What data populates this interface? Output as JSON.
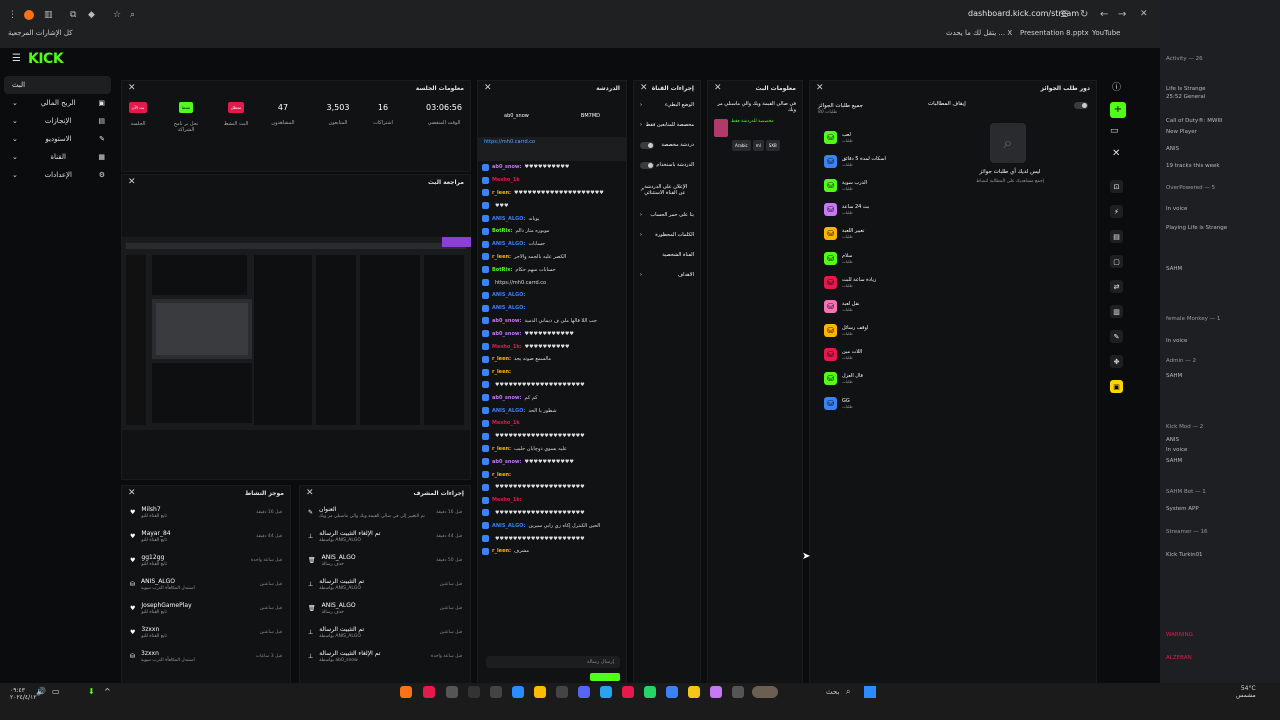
{
  "browser": {
    "url": "dashboard.kick.com/stream",
    "bookmarks": [
      {
        "label": "كل الإشارات المرجعية"
      },
      {
        "label": "يتقل لك ما يحدث ... X"
      },
      {
        "label": "Presentation 8.pptx"
      },
      {
        "label": "YouTube"
      }
    ]
  },
  "app": {
    "logo": "KICK",
    "sidebar": [
      {
        "label": "البث",
        "active": true
      },
      {
        "label": "الربح المالي"
      },
      {
        "label": "الإنجازات"
      },
      {
        "label": "الاستوديو"
      },
      {
        "label": "القناة"
      },
      {
        "label": "الإعدادات"
      }
    ]
  },
  "session": {
    "title": "معلومات الجلسة",
    "stats": [
      {
        "value": "",
        "label": "الجلسة",
        "badge": "بث الآن",
        "badge_color": "#e5194b"
      },
      {
        "value": "",
        "label": "نحل بر نامج الشراكة",
        "badge": "نشط",
        "badge_color": "#53fc18"
      },
      {
        "value": "",
        "label": "البث النشط",
        "badge": "معطل",
        "badge_color": "#e5194b"
      },
      {
        "value": "47",
        "label": "المشاهدون"
      },
      {
        "value": "3,503",
        "label": "المتابعون"
      },
      {
        "value": "16",
        "label": "اشتراكات"
      },
      {
        "value": "03:06:56",
        "label": "الوقت المنقضي"
      }
    ]
  },
  "preview": {
    "title": "مراجعة البث"
  },
  "activity": {
    "title": "موجز النشاط",
    "items": [
      {
        "name": "Milsh7",
        "sub": "تابع القناة للتو",
        "time": "قبل 16 دقيقة"
      },
      {
        "name": "Mayar_84",
        "sub": "تابع القناة للتو",
        "time": "قبل 44 دقيقة"
      },
      {
        "name": "gg12gg",
        "sub": "تابع القناة للتو",
        "time": "قبل ساعة واحدة"
      },
      {
        "name": "ANIS_ALGO",
        "sub": "استبدل المكافأة الدرب سوية",
        "time": "قبل ساعتين"
      },
      {
        "name": "JosephGamePlay",
        "sub": "تابع القناة للتو",
        "time": "قبل ساعتين"
      },
      {
        "name": "3zxxn",
        "sub": "تابع القناة للتو",
        "time": "قبل ساعتين"
      },
      {
        "name": "3zxxn",
        "sub": "استبدل المكافأة الدرب سوية",
        "time": "قبل 3 ساعات"
      }
    ]
  },
  "modactions": {
    "title": "إجراءات المشرف",
    "items": [
      {
        "name": "العنوان",
        "sub": "تم التغيير إلى في صالي القيمة ويك والي ماسنلي مر ويك",
        "time": "قبل 16 دقيقة"
      },
      {
        "name": "تم الإلغاء التثبيت الرسالة",
        "sub": "بواسطة ANIS_ALGO",
        "time": "قبل 44 دقيقة"
      },
      {
        "name": "ANIS_ALGO",
        "sub": "حذف رسالة",
        "time": "قبل 50 دقيقة"
      },
      {
        "name": "تم التثبيت الرسالة",
        "sub": "بواسطة ANIS_ALGO",
        "time": "قبل ساعتين"
      },
      {
        "name": "ANIS_ALGO",
        "sub": "حذف رسالة",
        "time": "قبل ساعتين"
      },
      {
        "name": "تم التثبيت الرسالة",
        "sub": "بواسطة ANIS_ALGO",
        "time": "قبل ساعتين"
      },
      {
        "name": "تم الإلغاء التثبيت الرسالة",
        "sub": "بواسطة ab0_snow",
        "time": "قبل ساعة واحدة"
      }
    ]
  },
  "chat": {
    "title": "الدردشة",
    "pinned_top": {
      "a": "ab0_snow",
      "b": "BM7MD"
    },
    "pinned_link": "https://mh0.carrd.co",
    "input_placeholder": "إرسال رسالة",
    "messages": [
      {
        "user": "ab0_snow:",
        "color": "#c678f5",
        "text": "♥♥♥♥♥♥♥♥♥♥"
      },
      {
        "user": "Mesho_1k",
        "color": "#e5194b",
        "text": ""
      },
      {
        "user": "r_leen:",
        "color": "#ffb400",
        "text": "♥♥♥♥♥♥♥♥♥♥♥♥♥♥♥♥♥♥♥♥"
      },
      {
        "user": "",
        "color": "#fff",
        "text": "♥♥♥"
      },
      {
        "user": "ANIS_ALGO:",
        "color": "#3b82f6",
        "text": "يوبانه"
      },
      {
        "user": "BotRix:",
        "color": "#53fc18",
        "text": "موبوره متار دالم"
      },
      {
        "user": "ANIS_ALGO:",
        "color": "#3b82f6",
        "text": "حسابات"
      },
      {
        "user": "r_leen:",
        "color": "#ffb400",
        "text": "الكصر عليه بالجمه والاجر"
      },
      {
        "user": "BotRix:",
        "color": "#53fc18",
        "text": "حسابات سهم حكام"
      },
      {
        "user": "",
        "color": "#3b82f6",
        "text": "https://mh0.carrd.co"
      },
      {
        "user": "ANIS_ALGO:",
        "color": "#3b82f6",
        "text": ""
      },
      {
        "user": "ANIS_ALGO:",
        "color": "#3b82f6",
        "text": ""
      },
      {
        "user": "ab0_snow:",
        "color": "#c678f5",
        "text": "جب اللا قالها ملي ف ديماني الدمية"
      },
      {
        "user": "ab0_snow:",
        "color": "#c678f5",
        "text": "♥♥♥♥♥♥♥♥♥♥♥"
      },
      {
        "user": "Mesho_1k:",
        "color": "#e5194b",
        "text": "♥♥♥♥♥♥♥♥♥♥"
      },
      {
        "user": "r_leen:",
        "color": "#ffb400",
        "text": "مالسمع صوته يجد"
      },
      {
        "user": "r_leen:",
        "color": "#ffb400",
        "text": ""
      },
      {
        "user": "",
        "color": "#fff",
        "text": "♥♥♥♥♥♥♥♥♥♥♥♥♥♥♥♥♥♥♥♥"
      },
      {
        "user": "ab0_snow:",
        "color": "#c678f5",
        "text": "كم كم"
      },
      {
        "user": "ANIS_ALGO:",
        "color": "#3b82f6",
        "text": "شطور يا الحد"
      },
      {
        "user": "Mesho_1k",
        "color": "#e5194b",
        "text": ""
      },
      {
        "user": "",
        "color": "#fff",
        "text": "♥♥♥♥♥♥♥♥♥♥♥♥♥♥♥♥♥♥♥♥"
      },
      {
        "user": "r_leen:",
        "color": "#ffb400",
        "text": "عليه يسوي دوچايان حليب"
      },
      {
        "user": "ab0_snow:",
        "color": "#c678f5",
        "text": "♥♥♥♥♥♥♥♥♥♥♥"
      },
      {
        "user": "r_leen:",
        "color": "#ffb400",
        "text": ""
      },
      {
        "user": "",
        "color": "#fff",
        "text": "♥♥♥♥♥♥♥♥♥♥♥♥♥♥♥♥♥♥♥♥"
      },
      {
        "user": "Mesho_1k:",
        "color": "#e5194b",
        "text": ""
      },
      {
        "user": "",
        "color": "#fff",
        "text": "♥♥♥♥♥♥♥♥♥♥♥♥♥♥♥♥♥♥♥♥"
      },
      {
        "user": "ANIS_ALGO:",
        "color": "#3b82f6",
        "text": "الحين الكنترل إكاه زي رابي سيرين"
      },
      {
        "user": "",
        "color": "#fff",
        "text": "♥♥♥♥♥♥♥♥♥♥♥♥♥♥♥♥♥♥♥♥"
      },
      {
        "user": "r_leen:",
        "color": "#ffb400",
        "text": "مشرف"
      }
    ]
  },
  "quick": {
    "title": "إجراءات القناة",
    "items": [
      {
        "label": "الوضع البطيء"
      },
      {
        "label": "مخصصة للمتابعين فقط"
      },
      {
        "label": "دردشة مخصصة",
        "toggle": true
      },
      {
        "label": "الدردشة باستخدام",
        "toggle": true
      },
      {
        "label": "الإعلان على الدردشة عن القناة الاستثنائي"
      },
      {
        "label": "بتا على حمر الحساب"
      },
      {
        "label": "الكلمات المحظورة"
      },
      {
        "label": "الفناة الشخصية"
      },
      {
        "label": "الاهداف"
      }
    ]
  },
  "streaminfo": {
    "title": "معلومات البث",
    "stream_title": "في صالي القيمة ويك والي ماسنلي مر ويك",
    "category": "مخصصة للدردشة فقط",
    "tags": [
      "Arabic",
      "ml",
      "SXB"
    ]
  },
  "rewards": {
    "title": "دور طلب الجوائز",
    "subtitle": "جميع طلبات الجوائز",
    "count": "80 طلبات",
    "items": [
      {
        "name": "لعب",
        "color": "#53fc18"
      },
      {
        "name": "اسكات لمدة 5 دقائق",
        "color": "#3b82f6"
      },
      {
        "name": "الدرب سوية",
        "color": "#53fc18"
      },
      {
        "name": "بث 24 ساعة",
        "color": "#c678f5"
      },
      {
        "name": "تغيير اللعبة",
        "color": "#ffb400"
      },
      {
        "name": "سلام",
        "color": "#53fc18"
      },
      {
        "name": "زيادة ساعة للبث",
        "color": "#e5194b"
      },
      {
        "name": "نقل لعبة",
        "color": "#f472b6"
      },
      {
        "name": "اوقف رسائل",
        "color": "#ffb400"
      },
      {
        "name": "اللات مين",
        "color": "#e5194b"
      },
      {
        "name": "قال العزل",
        "color": "#53fc18"
      },
      {
        "name": "GG",
        "color": "#3b82f6"
      }
    ],
    "item_sub": "طلبات",
    "pause_label": "إيقاف المطالبات",
    "empty_title": "ليس لديك أي طلبات جوائز",
    "empty_sub": "إجمع مشاهديك على المطالبة لتشاط"
  },
  "discord": {
    "entries": [
      {
        "text": "Activity — 26"
      },
      {
        "text": "Life Is Strange"
      },
      {
        "text": "25:52 General"
      },
      {
        "text": "Call of Duty®: MWIII"
      },
      {
        "text": "New Player"
      },
      {
        "text": "ANIS"
      },
      {
        "text": "19 tracks this week"
      },
      {
        "text": "OverPowered — 5"
      },
      {
        "text": "In voice"
      },
      {
        "text": "Playing Life is Strange"
      },
      {
        "text": "SAHM"
      },
      {
        "text": "female Monkey — 1"
      },
      {
        "text": "In voice"
      },
      {
        "text": "Admin — 2"
      },
      {
        "text": "SAHM"
      },
      {
        "text": "Kick Mod — 2"
      },
      {
        "text": "ANIS"
      },
      {
        "text": "In voice"
      },
      {
        "text": "SAHM"
      },
      {
        "text": "SAHM Bot — 1"
      },
      {
        "text": "System APP"
      },
      {
        "text": "Streamer — 16"
      },
      {
        "text": "Kick Turkin01"
      },
      {
        "text": "WARNING"
      },
      {
        "text": "ALZEBAN"
      }
    ]
  },
  "taskbar": {
    "search_label": "بحث",
    "time": "٠٩:٤٣",
    "date": "٢٠٢٤/٤/١٢",
    "weather": "54°C",
    "weather_sub": "مشمس"
  }
}
